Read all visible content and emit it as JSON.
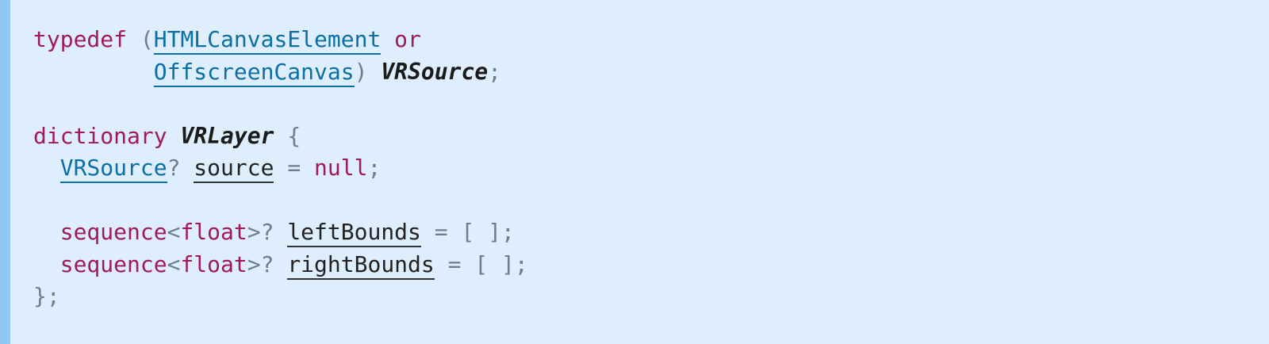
{
  "idl": {
    "typedef_keyword": "typedef",
    "open_paren": "(",
    "canvas_type": "HTMLCanvasElement",
    "or_keyword": "or",
    "offscreen_type": "OffscreenCanvas",
    "close_paren": ")",
    "typedef_name": "VRSource",
    "typedef_end": ";",
    "dictionary_keyword": "dictionary",
    "dictionary_name": "VRLayer",
    "open_brace": "{",
    "source_member": {
      "type": "VRSource",
      "nullable": "?",
      "name": "source",
      "equals": "=",
      "default": "null",
      "end": ";"
    },
    "left_member": {
      "sequence": "sequence",
      "lt": "<",
      "float": "float",
      "gt": ">",
      "nullable": "?",
      "name": "leftBounds",
      "default": "= [ ];"
    },
    "right_member": {
      "sequence": "sequence",
      "lt": "<",
      "float": "float",
      "gt": ">",
      "nullable": "?",
      "name": "rightBounds",
      "default": "= [ ];"
    },
    "close_brace": "};"
  },
  "colors": {
    "background": "#deeefd",
    "left_bar": "#90c8f4",
    "keyword": "#a0195a",
    "link": "#0b6fa6",
    "punctuation": "#707d8a"
  }
}
